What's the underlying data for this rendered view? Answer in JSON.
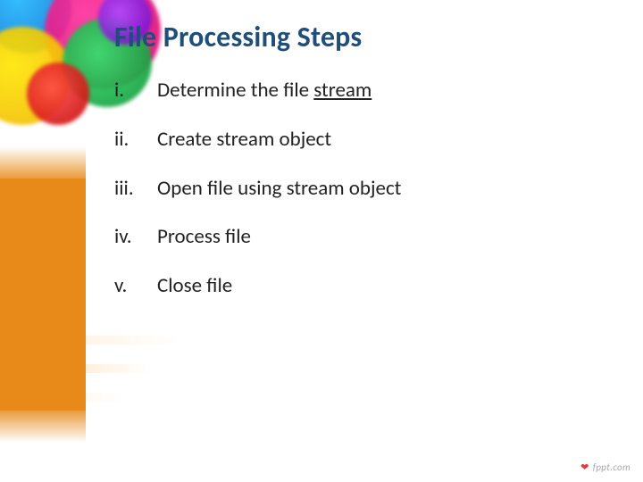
{
  "title": "File Processing Steps",
  "steps": [
    {
      "numeral": "i.",
      "text_pre": "Determine the file ",
      "text_underlined": "stream",
      "text_post": ""
    },
    {
      "numeral": "ii.",
      "text_pre": "Create stream object",
      "text_underlined": "",
      "text_post": ""
    },
    {
      "numeral": "iii.",
      "text_pre": "Open file using stream object",
      "text_underlined": "",
      "text_post": ""
    },
    {
      "numeral": "iv.",
      "text_pre": "Process file",
      "text_underlined": "",
      "text_post": ""
    },
    {
      "numeral": "v.",
      "text_pre": "Close file",
      "text_underlined": "",
      "text_post": ""
    }
  ],
  "footer": "fppt.com"
}
